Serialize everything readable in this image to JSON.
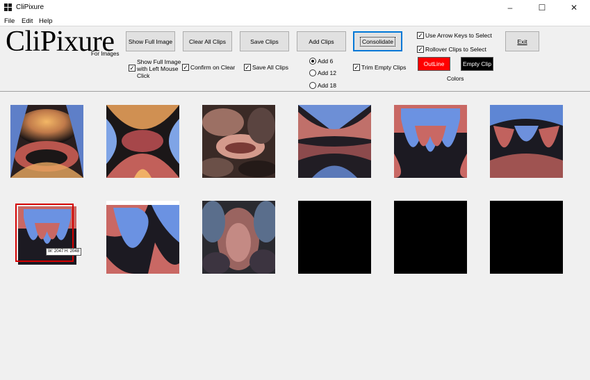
{
  "window": {
    "title": "CliPixure",
    "controls": [
      "–",
      "☐",
      "✕"
    ]
  },
  "menu": {
    "items": [
      "File",
      "Edit",
      "Help"
    ]
  },
  "logo": {
    "title": "CliPixure",
    "subtitle": "For Images"
  },
  "toolbar": {
    "buttons": {
      "show_full_image": "Show Full Image",
      "clear_all_clips": "Clear All Clips",
      "save_clips": "Save Clips",
      "add_clips": "Add Clips",
      "consolidate": "Consolidate",
      "exit": "Exit"
    },
    "checkboxes": {
      "show_full_image_left_click": {
        "label": "Show Full Image with Left Mouse Click",
        "checked": true
      },
      "confirm_on_clear": {
        "label": "Confirm on Clear",
        "checked": true
      },
      "save_all_clips": {
        "label": "Save All Clips",
        "checked": true
      },
      "trim_empty_clips": {
        "label": "Trim Empty Clips",
        "checked": true
      },
      "use_arrow_keys": {
        "label": "Use Arrow Keys to Select",
        "checked": true
      },
      "rollover_clips": {
        "label": "Rollover Clips to Select",
        "checked": true
      }
    },
    "radios": [
      {
        "label": "Add 6",
        "selected": true
      },
      {
        "label": "Add 12",
        "selected": false
      },
      {
        "label": "Add 18",
        "selected": false
      }
    ],
    "colors": {
      "outline_label": "OutLine",
      "outline_color": "#ff0000",
      "empty_clip_label": "Empty Clip",
      "empty_clip_color": "#000000",
      "caption": "Colors"
    }
  },
  "clips": {
    "tooltip": "W: 2047 H: 2048",
    "items": [
      {
        "name": "clip-1",
        "style": "fractal-gold-red",
        "empty": false
      },
      {
        "name": "clip-2",
        "style": "fractal-gold-blue",
        "empty": false
      },
      {
        "name": "clip-3",
        "style": "fractal-marble",
        "empty": false
      },
      {
        "name": "clip-4",
        "style": "fractal-symmetric-dark",
        "empty": false
      },
      {
        "name": "clip-5",
        "style": "fractal-blue-red",
        "empty": false
      },
      {
        "name": "clip-6",
        "style": "fractal-blue-red-dark",
        "empty": false
      },
      {
        "name": "clip-7",
        "style": "fractal-blue-red-small",
        "empty": false,
        "selected": true
      },
      {
        "name": "clip-8",
        "style": "fractal-blue-red-zoom",
        "empty": false
      },
      {
        "name": "clip-9",
        "style": "fractal-stone",
        "empty": false
      },
      {
        "name": "clip-10",
        "style": "empty",
        "empty": true
      },
      {
        "name": "clip-11",
        "style": "empty",
        "empty": true
      },
      {
        "name": "clip-12",
        "style": "empty",
        "empty": true
      }
    ]
  }
}
